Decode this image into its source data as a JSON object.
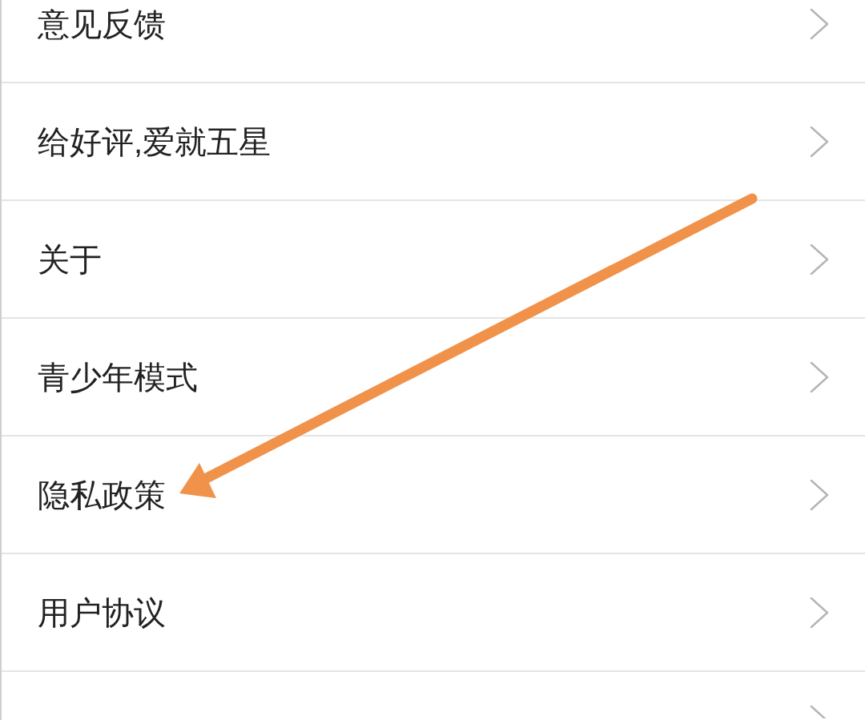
{
  "menu": {
    "items": [
      {
        "label": "意见反馈"
      },
      {
        "label": "给好评,爱就五星"
      },
      {
        "label": "关于"
      },
      {
        "label": "青少年模式"
      },
      {
        "label": "隐私政策"
      },
      {
        "label": "用户协议"
      }
    ]
  }
}
